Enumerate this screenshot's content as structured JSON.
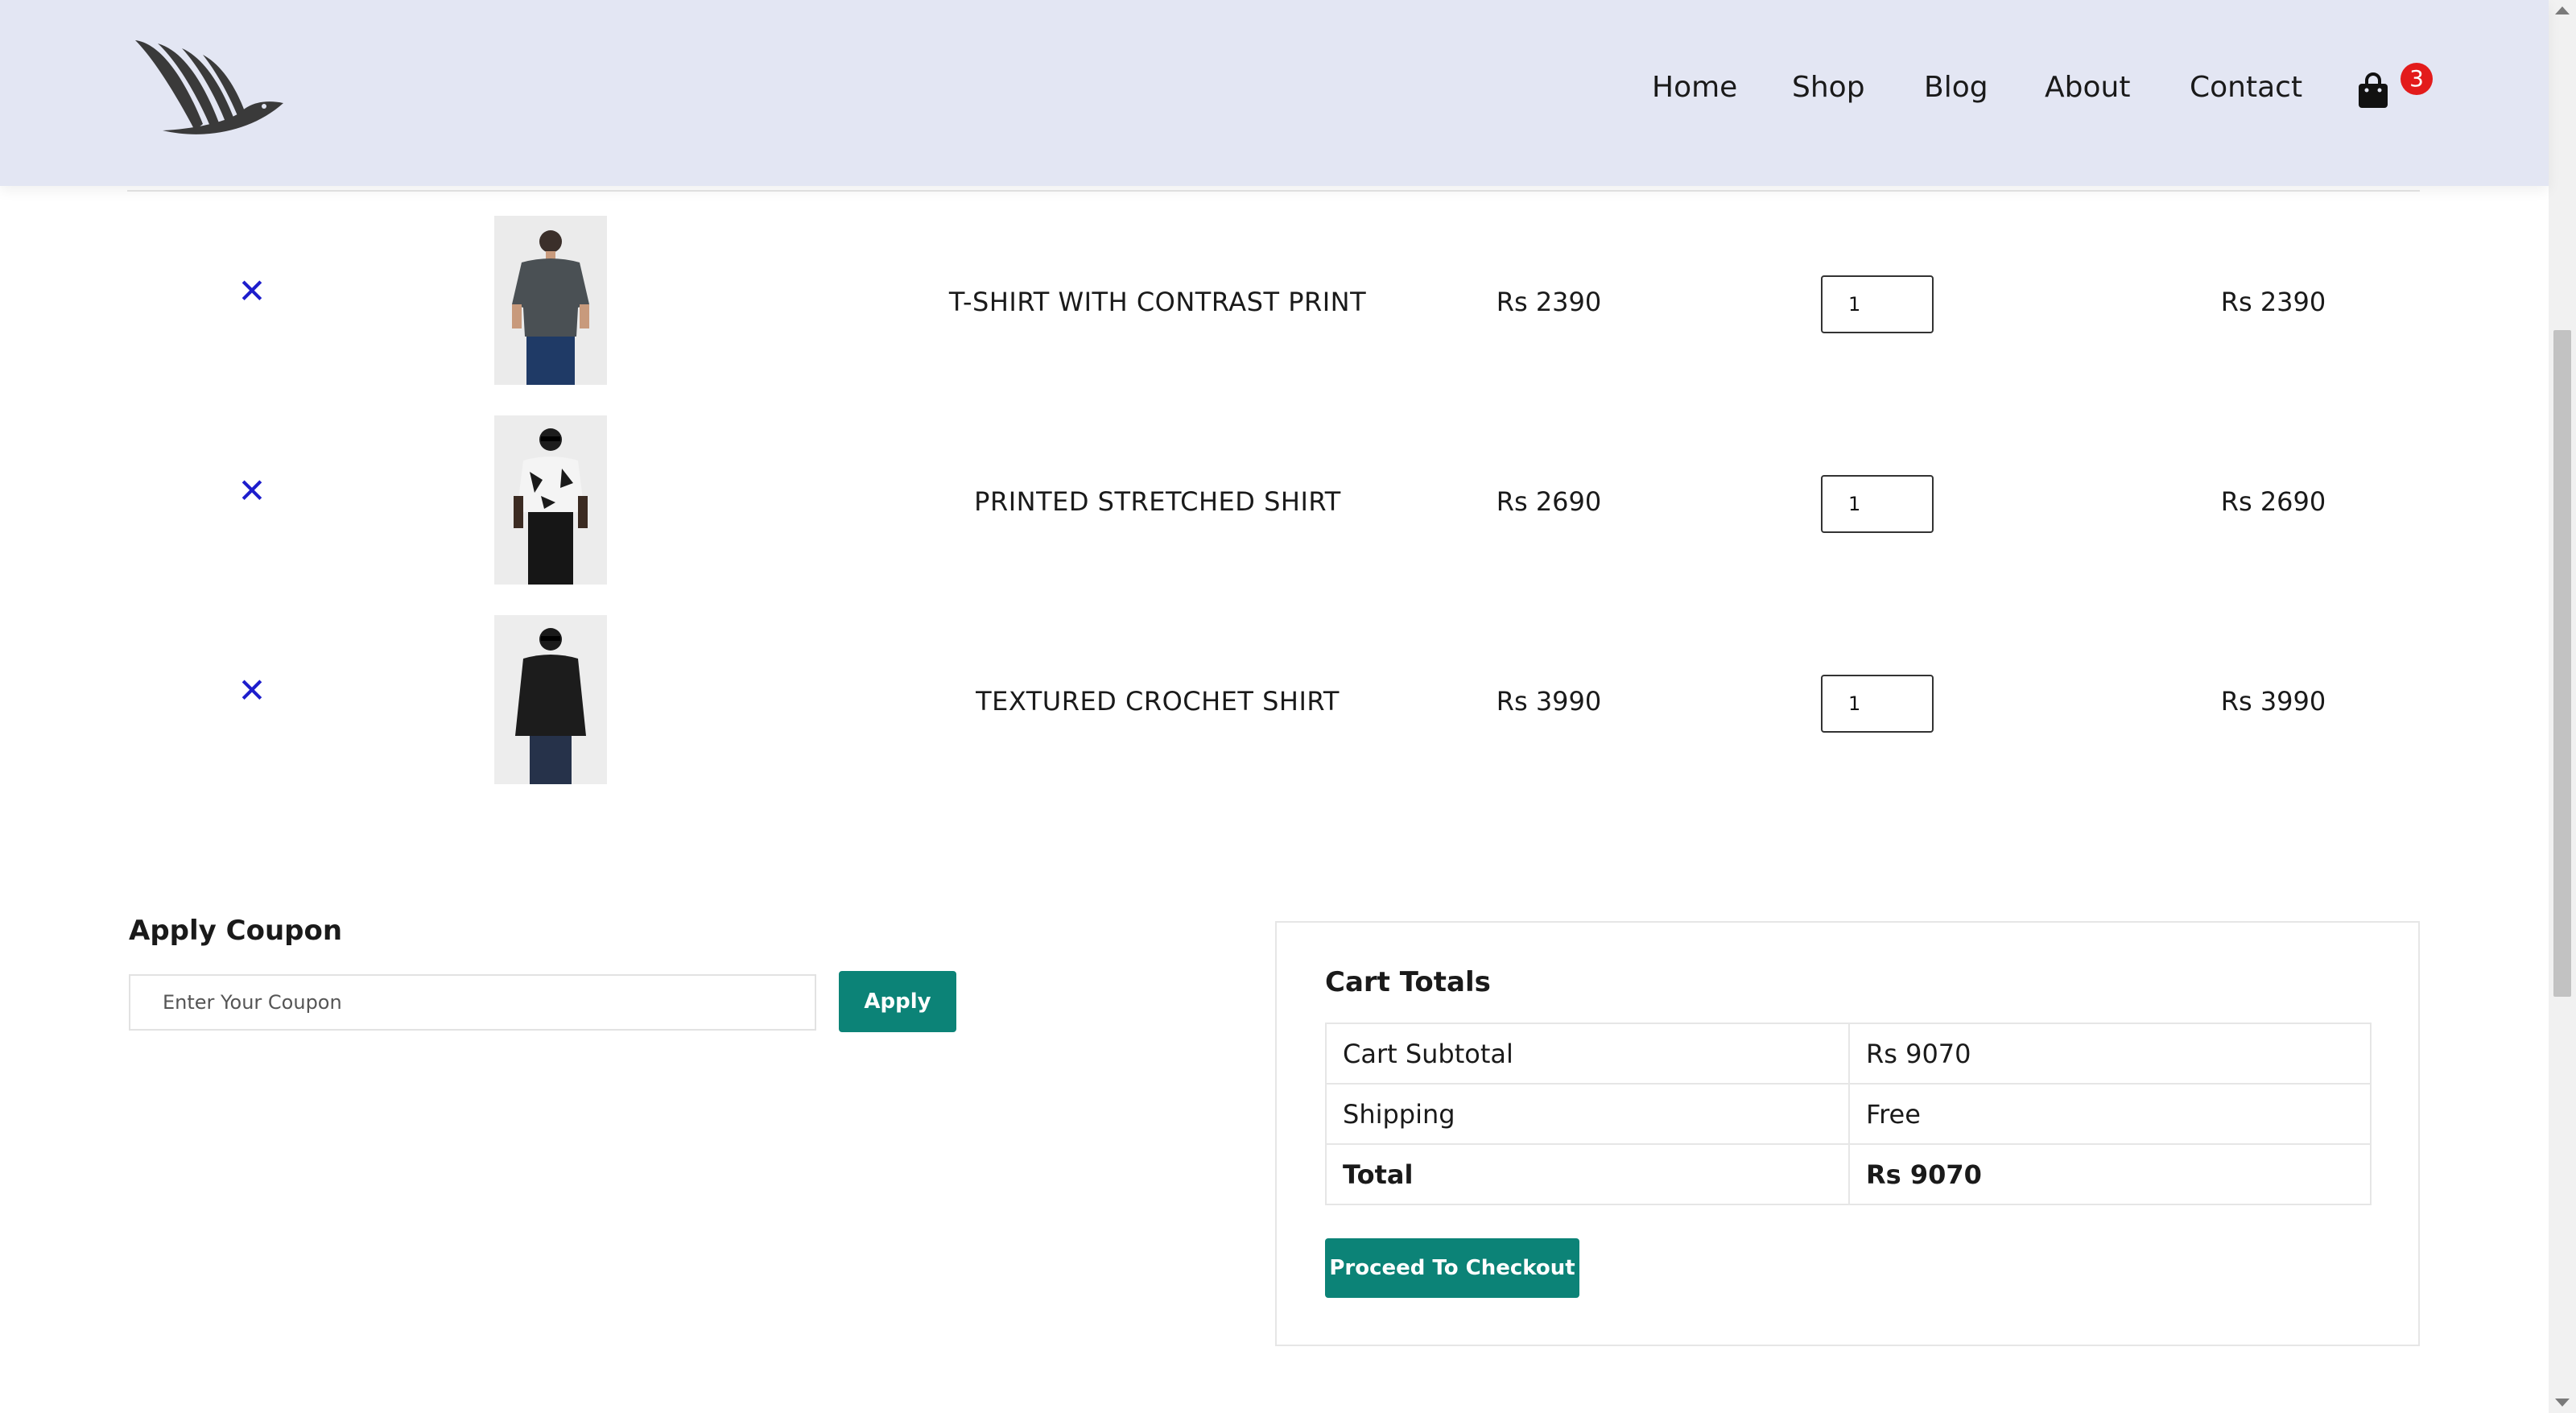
{
  "nav": {
    "items": [
      {
        "label": "Home"
      },
      {
        "label": "Shop"
      },
      {
        "label": "Blog"
      },
      {
        "label": "About"
      },
      {
        "label": "Contact"
      }
    ],
    "cart_count": "3",
    "cart_icon": "shopping-bag-icon"
  },
  "logo": {
    "icon": "bird-logo-icon"
  },
  "cart": {
    "items": [
      {
        "name": "T-SHIRT WITH CONTRAST PRINT",
        "price": "Rs 2390",
        "quantity": "1",
        "subtotal": "Rs 2390",
        "remove_icon": "close-icon"
      },
      {
        "name": "PRINTED STRETCHED SHIRT",
        "price": "Rs 2690",
        "quantity": "1",
        "subtotal": "Rs 2690",
        "remove_icon": "close-icon"
      },
      {
        "name": "TEXTURED CROCHET SHIRT",
        "price": "Rs 3990",
        "quantity": "1",
        "subtotal": "Rs 3990",
        "remove_icon": "close-icon"
      }
    ]
  },
  "coupon": {
    "title": "Apply Coupon",
    "placeholder": "Enter Your Coupon",
    "apply_label": "Apply"
  },
  "totals": {
    "title": "Cart Totals",
    "rows": [
      {
        "label": "Cart Subtotal",
        "value": "Rs 9070"
      },
      {
        "label": "Shipping",
        "value": "Free"
      },
      {
        "label": "Total",
        "value": "Rs 9070"
      }
    ],
    "checkout_label": "Proceed To Checkout"
  },
  "colors": {
    "header_bg": "#e3e6f3",
    "accent": "#0c8377",
    "remove": "#1d1dcc",
    "badge": "#e31b1b"
  }
}
